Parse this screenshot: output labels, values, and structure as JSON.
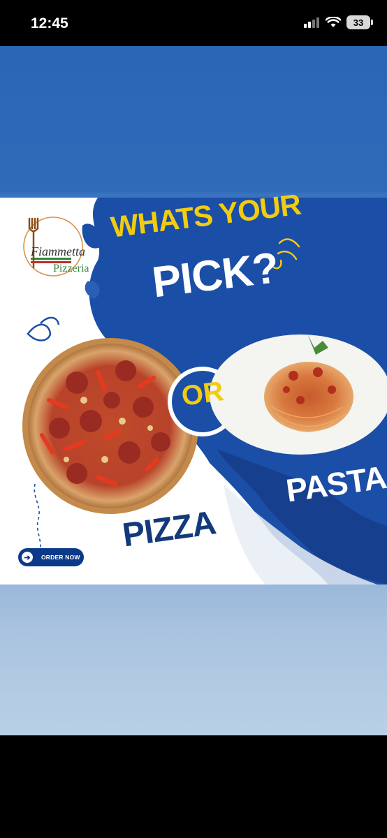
{
  "status": {
    "time": "12:45",
    "battery": "33"
  },
  "post": {
    "brand_line1": "Fiammetta",
    "brand_line2": "Pizzeria",
    "headline_line1": "WHATS YOUR",
    "headline_line2": "PICK?",
    "or_label": "OR",
    "pizza_label": "PIZZA",
    "pasta_label": "PASTA",
    "cta_label": "ORDER NOW"
  },
  "colors": {
    "brand_blue": "#1b4ea6",
    "accent_yellow": "#f2cc10",
    "dark_blue": "#123a7a"
  },
  "icons": [
    "signal-icon",
    "wifi-icon",
    "battery-icon",
    "fork-icon",
    "arrow-right-icon"
  ]
}
